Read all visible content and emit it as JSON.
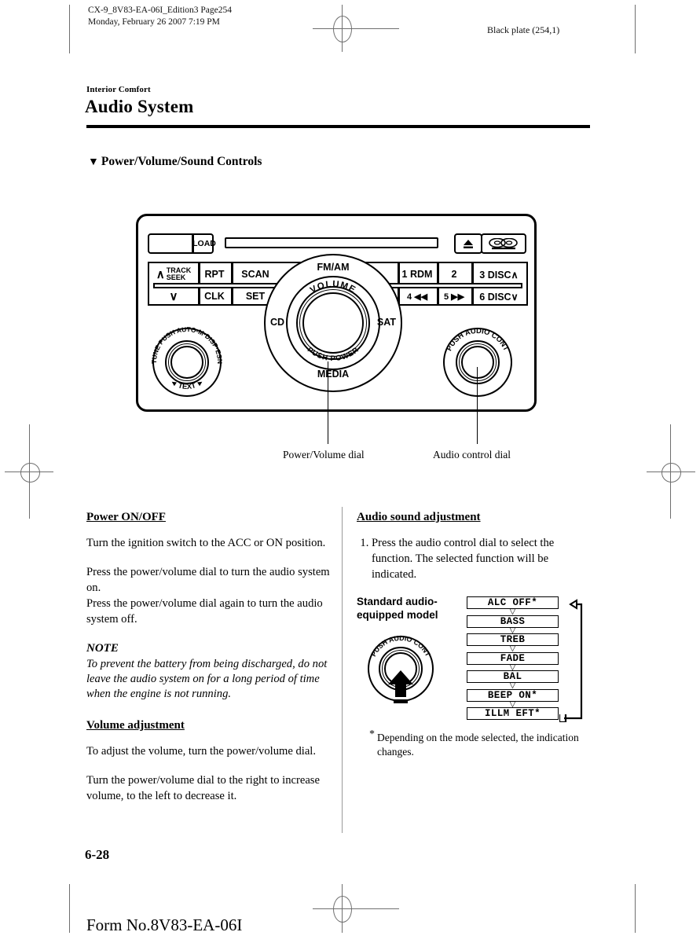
{
  "header": {
    "doc_line1": "CX-9_8V83-EA-06I_Edition3 Page254",
    "doc_line2": "Monday, February 26 2007 7:19 PM",
    "plate": "Black plate (254,1)"
  },
  "section": {
    "kicker": "Interior Comfort",
    "title": "Audio System",
    "subheading": "Power/Volume/Sound Controls",
    "triangle_marker": "▼"
  },
  "radio": {
    "load_label": "LOAD",
    "eject_icon": "eject-icon",
    "cd_logo_text": "disc",
    "keys_top": [
      "TRACK SEEK",
      "RPT",
      "SCAN"
    ],
    "keys_bottom": [
      "",
      "CLK",
      "SET"
    ],
    "track_seek_up": "∧",
    "track_seek_down": "∨",
    "track_label_line1": "TRACK",
    "track_label_line2": "SEEK",
    "presets_top": [
      "1 RDM",
      "2",
      "3 DISC∧"
    ],
    "presets_bottom": [
      "4 ◀◀",
      "5 ▶▶",
      "6 DISC∨"
    ],
    "dial": {
      "top": "FM/AM",
      "bottom": "MEDIA",
      "left": "CD",
      "right": "SAT",
      "arc_top": "VOLUME",
      "arc_bottom": "PUSH POWER"
    },
    "left_knob": {
      "arc_top": "TUNE PUSH AUTO-M·DISP·ESN",
      "arc_bottom": "TEXT"
    },
    "right_knob": {
      "arc_top": "PUSH AUDIO CONT"
    }
  },
  "callouts": {
    "power_volume": "Power/Volume dial",
    "audio_control": "Audio control dial"
  },
  "left_column": {
    "power_heading": "Power ON/OFF",
    "power_p1": "Turn the ignition switch to the ACC or ON position.",
    "power_p2": "Press the power/volume dial to turn the audio system on.",
    "power_p3": "Press the power/volume dial again to turn the audio system off.",
    "note_heading": "NOTE",
    "note_body": "To prevent the battery from being discharged, do not leave the audio system on for a long period of time when the engine is not running.",
    "volume_heading": "Volume adjustment",
    "volume_p1": "To adjust the volume, turn the power/volume dial.",
    "volume_p2": "Turn the power/volume dial to the right to increase volume, to the left to decrease it."
  },
  "right_column": {
    "heading": "Audio sound adjustment",
    "step1": "Press the audio control dial to select the function. The selected function will be indicated.",
    "diagram_title": "Standard audio-equipped model",
    "knob_label": "PUSH AUDIO CONT",
    "functions": [
      "ALC OFF*",
      "BASS",
      "TREB",
      "FADE",
      "BAL",
      "BEEP ON*",
      "ILLM EFT*"
    ],
    "arrow_glyph": "▽",
    "footnote_marker": "*",
    "footnote_text": "Depending on the mode selected, the indication changes."
  },
  "footer": {
    "page_number": "6-28",
    "form_number": "Form No.8V83-EA-06I"
  },
  "colors": {
    "ink": "#000000",
    "rule": "#000000",
    "reg_mark": "#6f6f6f",
    "column_divider": "#9a9a9a"
  }
}
